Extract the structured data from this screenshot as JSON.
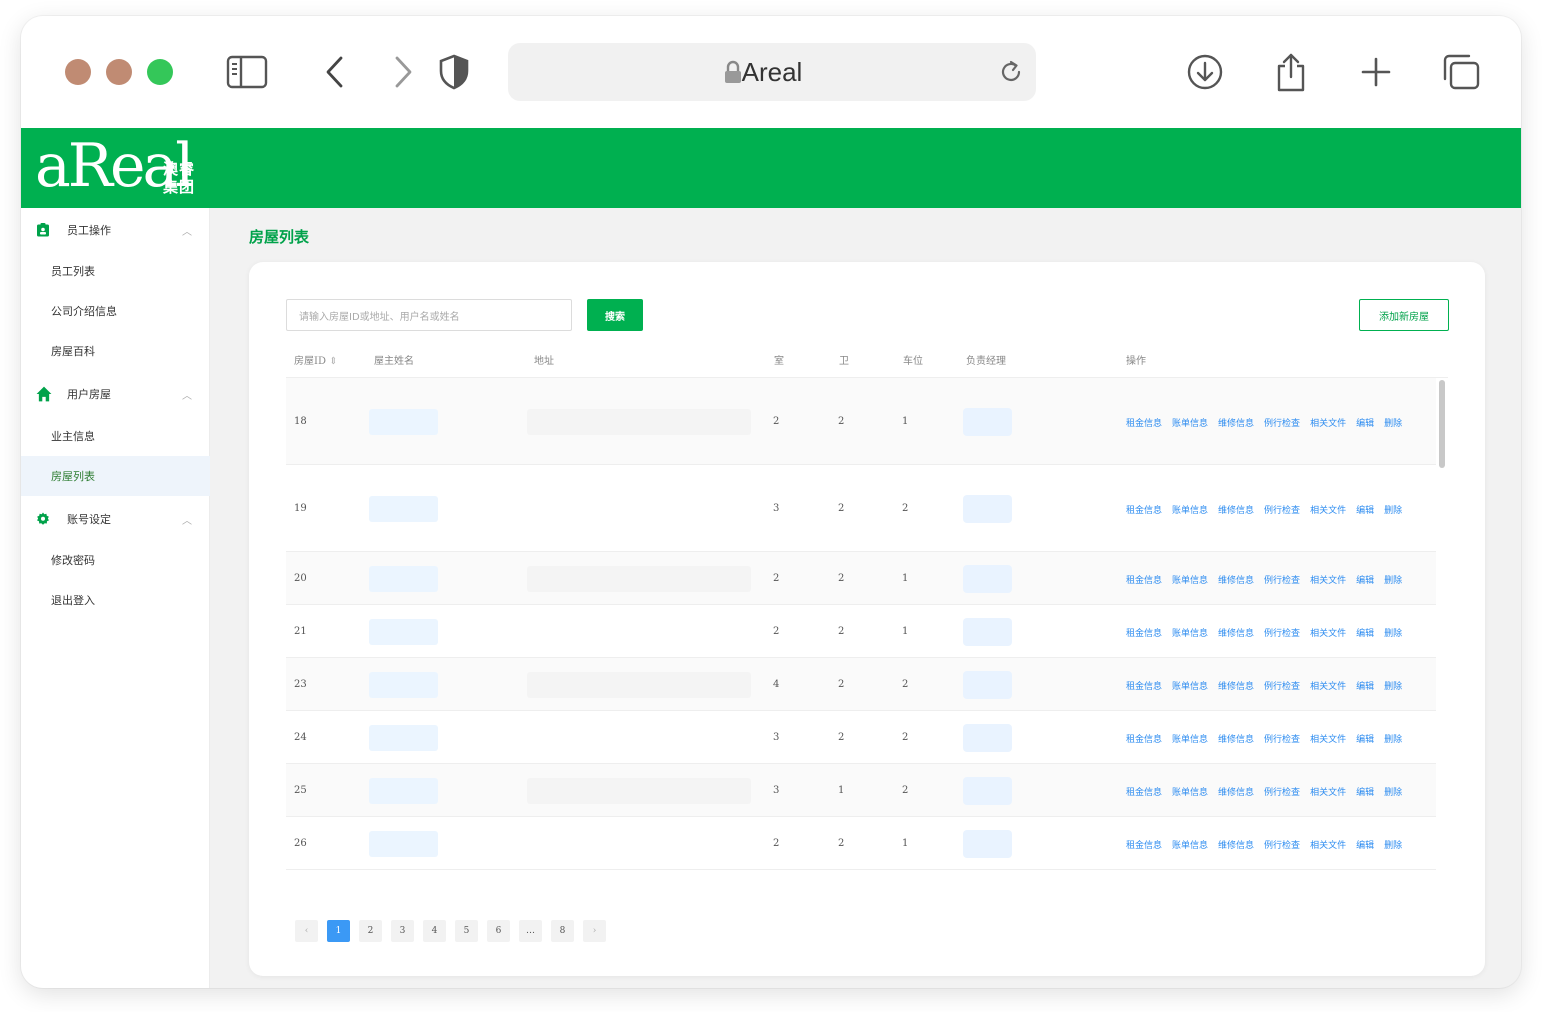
{
  "browser": {
    "address_text": "Areal",
    "icons": [
      "sidebar-icon",
      "back-icon",
      "forward-icon",
      "shield-icon",
      "lock-icon",
      "reload-icon",
      "download-icon",
      "share-icon",
      "new-tab-icon",
      "tabs-overview-icon"
    ]
  },
  "brand": {
    "logo_text": "aReal",
    "logo_cn": "澳睿集团",
    "color": "#00b050"
  },
  "sidebar": {
    "groups": [
      {
        "label": "员工操作",
        "icon": "badge-icon",
        "items": [
          "员工列表",
          "公司介绍信息",
          "房屋百科"
        ]
      },
      {
        "label": "用户房屋",
        "icon": "home-icon",
        "items": [
          "业主信息",
          "房屋列表"
        ]
      },
      {
        "label": "账号设定",
        "icon": "gear-icon",
        "items": [
          "修改密码",
          "退出登入"
        ]
      }
    ],
    "active_item": "房屋列表"
  },
  "page": {
    "title": "房屋列表",
    "search_placeholder": "请输入房屋ID或地址、用户名或姓名",
    "search_button": "搜索",
    "add_button": "添加新房屋"
  },
  "table": {
    "headers": [
      "房屋ID",
      "屋主姓名",
      "地址",
      "室",
      "卫",
      "车位",
      "负责经理",
      "操作"
    ],
    "sort_icon": "sort-icon",
    "rows": [
      {
        "id": "18",
        "rooms": "2",
        "baths": "2",
        "parking": "1"
      },
      {
        "id": "19",
        "rooms": "3",
        "baths": "2",
        "parking": "2"
      },
      {
        "id": "20",
        "rooms": "2",
        "baths": "2",
        "parking": "1"
      },
      {
        "id": "21",
        "rooms": "2",
        "baths": "2",
        "parking": "1"
      },
      {
        "id": "23",
        "rooms": "4",
        "baths": "2",
        "parking": "2"
      },
      {
        "id": "24",
        "rooms": "3",
        "baths": "2",
        "parking": "2"
      },
      {
        "id": "25",
        "rooms": "3",
        "baths": "1",
        "parking": "2"
      },
      {
        "id": "26",
        "rooms": "2",
        "baths": "2",
        "parking": "1"
      }
    ],
    "actions": [
      "租金信息",
      "账单信息",
      "维修信息",
      "例行检查",
      "相关文件",
      "编辑",
      "删除"
    ],
    "action_color": "#2d8cf0"
  },
  "pagination": {
    "prev": "‹",
    "pages": [
      "1",
      "2",
      "3",
      "4",
      "5",
      "6",
      "…",
      "8"
    ],
    "next": "›",
    "current": "1"
  }
}
